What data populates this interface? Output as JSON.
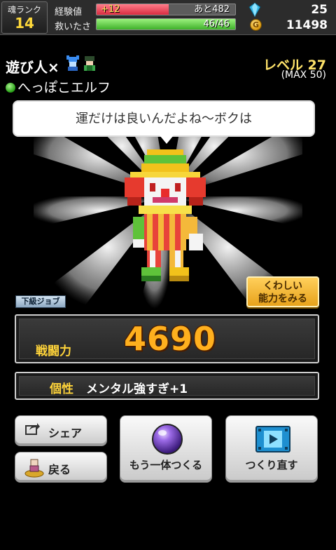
{
  "status": {
    "rank_label": "魂ランク",
    "rank_value": "14",
    "exp_label": "経験値",
    "exp_gain": "+12",
    "exp_remaining": "あと482",
    "exp_progress": 0.52,
    "rescue_label": "救いたさ",
    "rescue_value": "46/46",
    "rescue_progress": 1.0,
    "gems": "25",
    "gold": "11498",
    "coin_symbol": "G"
  },
  "character": {
    "name": "遊び人×",
    "race": "へっぽこエルフ",
    "level": "レベル 27",
    "max_level": "(MAX 50)",
    "speech": "運だけは良いんだよね〜ボクは",
    "job_tier": "下級ジョブ",
    "detail_button": [
      "くわしい",
      "能力をみる"
    ],
    "power_label": "戦闘力",
    "power_value": "4690",
    "trait_label": "個性",
    "trait_value": "メンタル強すぎ+1"
  },
  "buttons": {
    "share": "シェア",
    "back": "戻る",
    "create_another": "もう一体つくる",
    "recreate": "つくり直す"
  },
  "colors": {
    "exp_bar": "#e53a4d",
    "rescue_bar": "#5fd64c",
    "power_text": "#ffb01e",
    "label_gold": "#ffd43a"
  }
}
